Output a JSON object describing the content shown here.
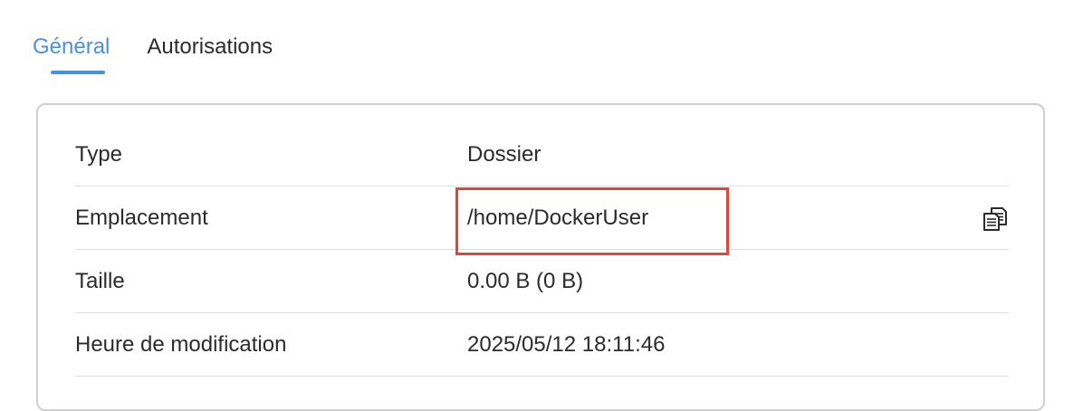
{
  "tabs": [
    {
      "label": "Général",
      "active": true
    },
    {
      "label": "Autorisations",
      "active": false
    }
  ],
  "properties": [
    {
      "label": "Type",
      "value": "Dossier"
    },
    {
      "label": "Emplacement",
      "value": "/home/DockerUser"
    },
    {
      "label": "Taille",
      "value": "0.00 B (0 B)"
    },
    {
      "label": "Heure de modification",
      "value": "2025/05/12 18:11:46"
    }
  ],
  "icons": {
    "copy": "copy-icon"
  },
  "colors": {
    "accent": "#4a90e2",
    "highlight": "#e0453a",
    "border": "#cfcfcf",
    "divider": "#dedede",
    "text": "#2b2b2b"
  }
}
